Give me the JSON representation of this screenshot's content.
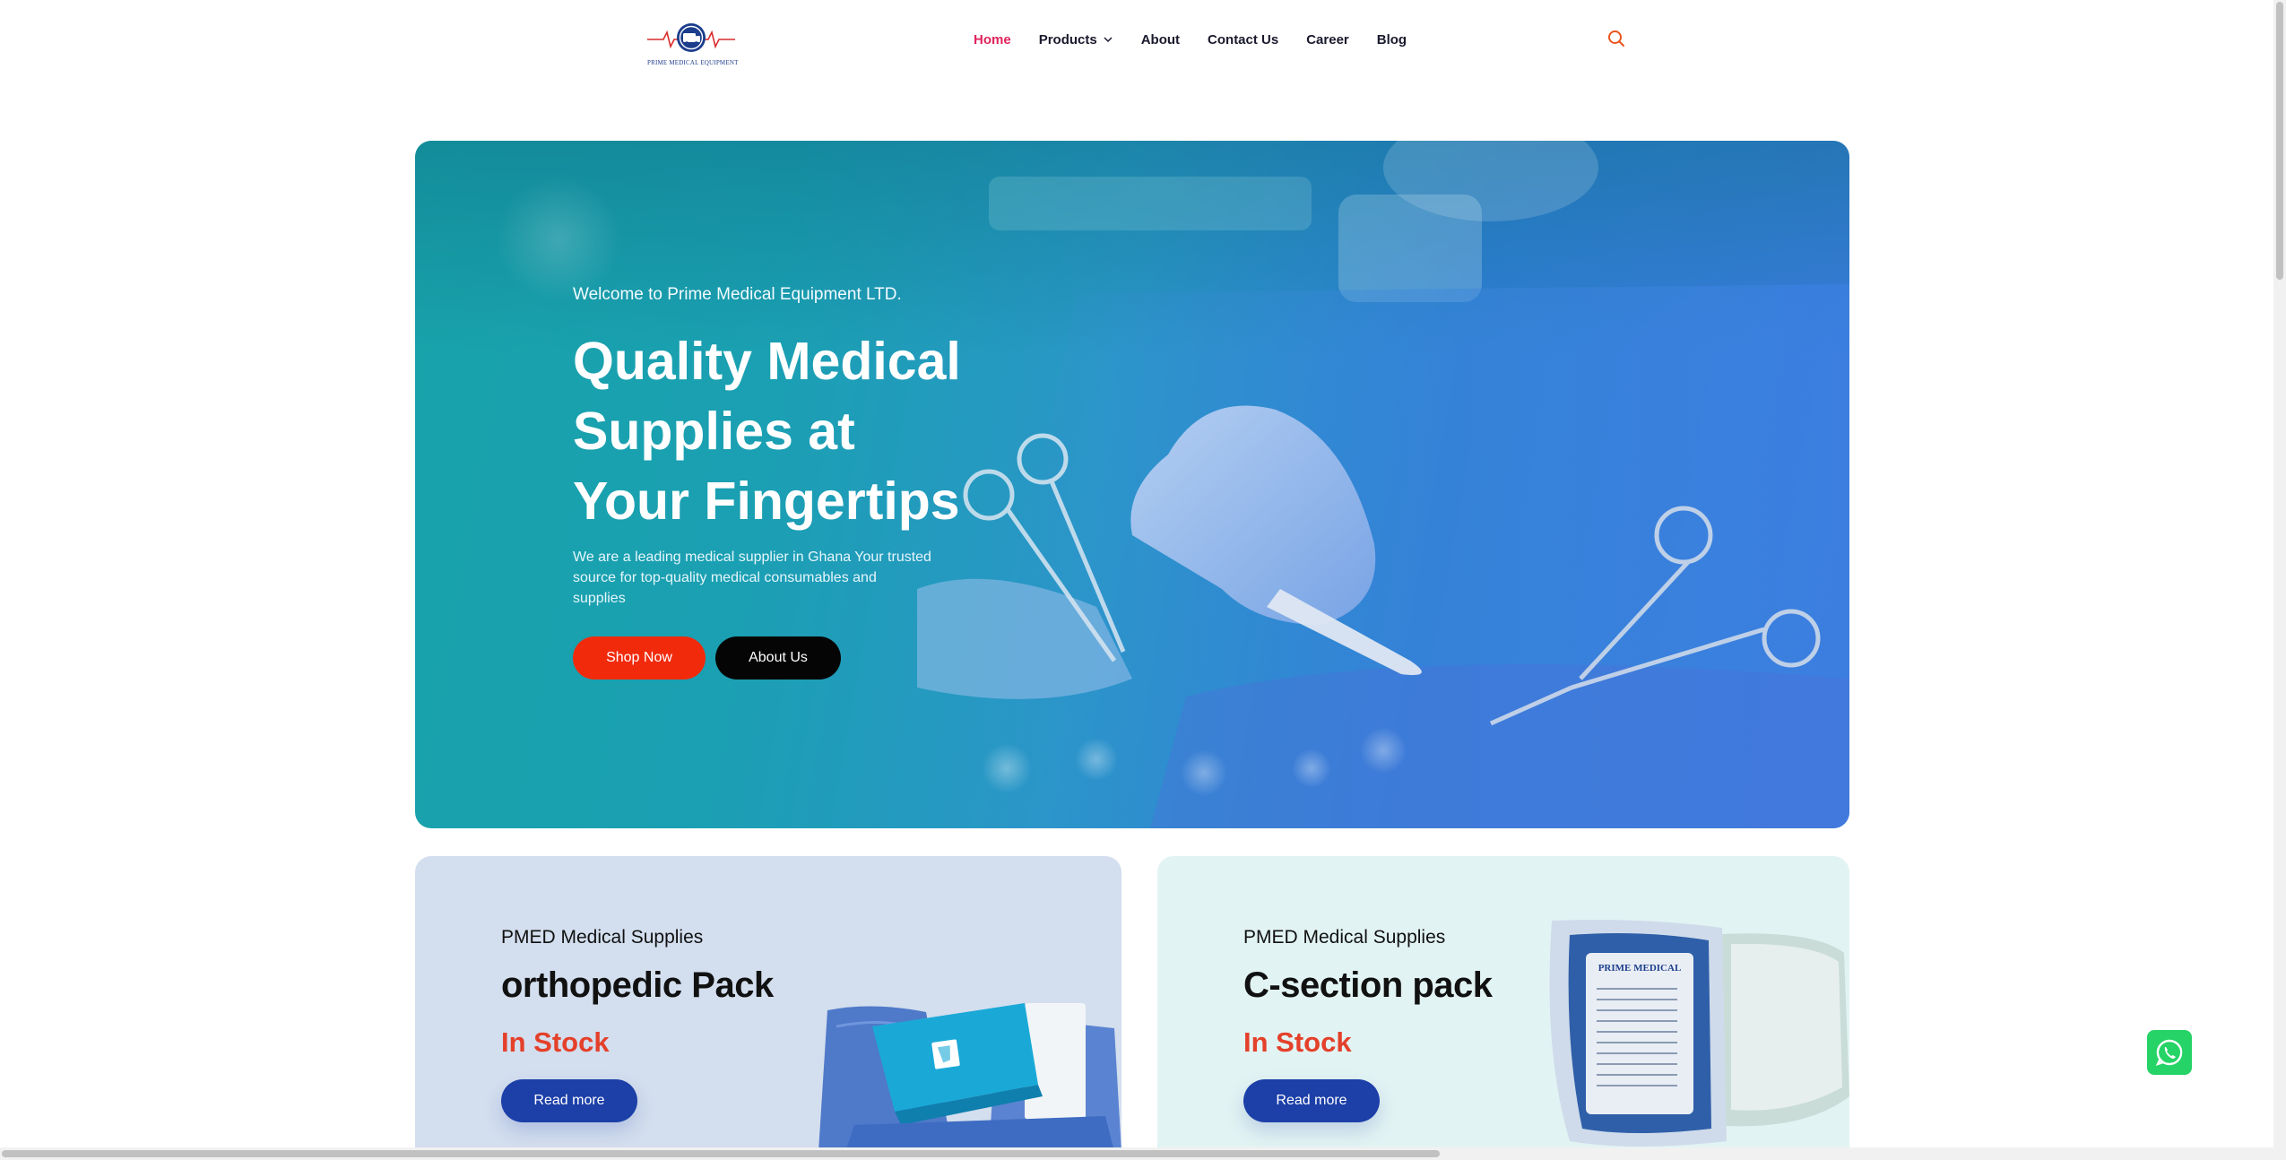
{
  "header": {
    "logo_text": "PRIME MEDICAL EQUIPMENT",
    "nav": [
      {
        "label": "Home",
        "active": true
      },
      {
        "label": "Products",
        "has_dropdown": true
      },
      {
        "label": "About"
      },
      {
        "label": "Contact Us"
      },
      {
        "label": "Career"
      },
      {
        "label": "Blog"
      }
    ],
    "search_icon": "search-icon",
    "colors": {
      "active_nav": "#e0245e",
      "search_icon": "#e8561e"
    }
  },
  "hero": {
    "welcome": "Welcome to Prime Medical Equipment LTD.",
    "title": "Quality Medical Supplies at Your Fingertips",
    "description": "We are a leading medical supplier in Ghana Your trusted source for top-quality medical consumables and supplies",
    "shop_button": "Shop Now",
    "about_button": "About Us",
    "colors": {
      "shop_button": "#f12a0c",
      "about_button": "#050505"
    }
  },
  "products": [
    {
      "subtitle": "PMED Medical Supplies",
      "title": "orthopedic Pack",
      "status": "In Stock",
      "button": "Read more",
      "background": "#d3deee"
    },
    {
      "subtitle": "PMED Medical Supplies",
      "title": "C-section pack",
      "status": "In Stock",
      "button": "Read more",
      "background": "#e2f3f3",
      "package_label": "PRIME MEDICAL"
    }
  ],
  "floating": {
    "whatsapp_icon": "whatsapp-icon",
    "color": "#25d366"
  }
}
